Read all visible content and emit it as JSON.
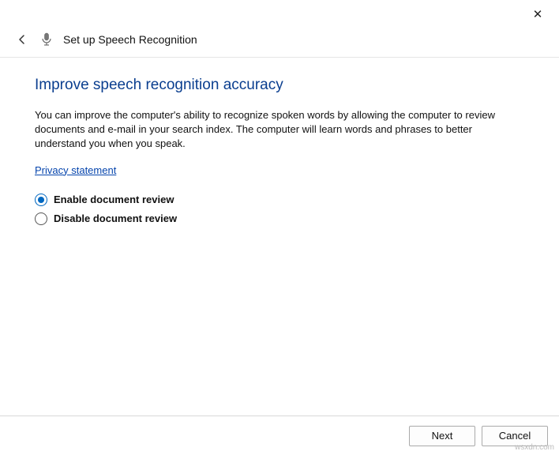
{
  "titlebar": {
    "close_symbol": "✕"
  },
  "header": {
    "title": "Set up Speech Recognition"
  },
  "content": {
    "heading": "Improve speech recognition accuracy",
    "description": "You can improve the computer's ability to recognize spoken words by allowing the computer to review documents and e-mail in your search index. The computer will learn words and phrases to better understand you when you speak.",
    "privacy_link": "Privacy statement",
    "options": {
      "enable": "Enable document review",
      "disable": "Disable document review",
      "selected": "enable"
    }
  },
  "footer": {
    "next": "Next",
    "cancel": "Cancel"
  },
  "watermark": "wsxdn.com"
}
